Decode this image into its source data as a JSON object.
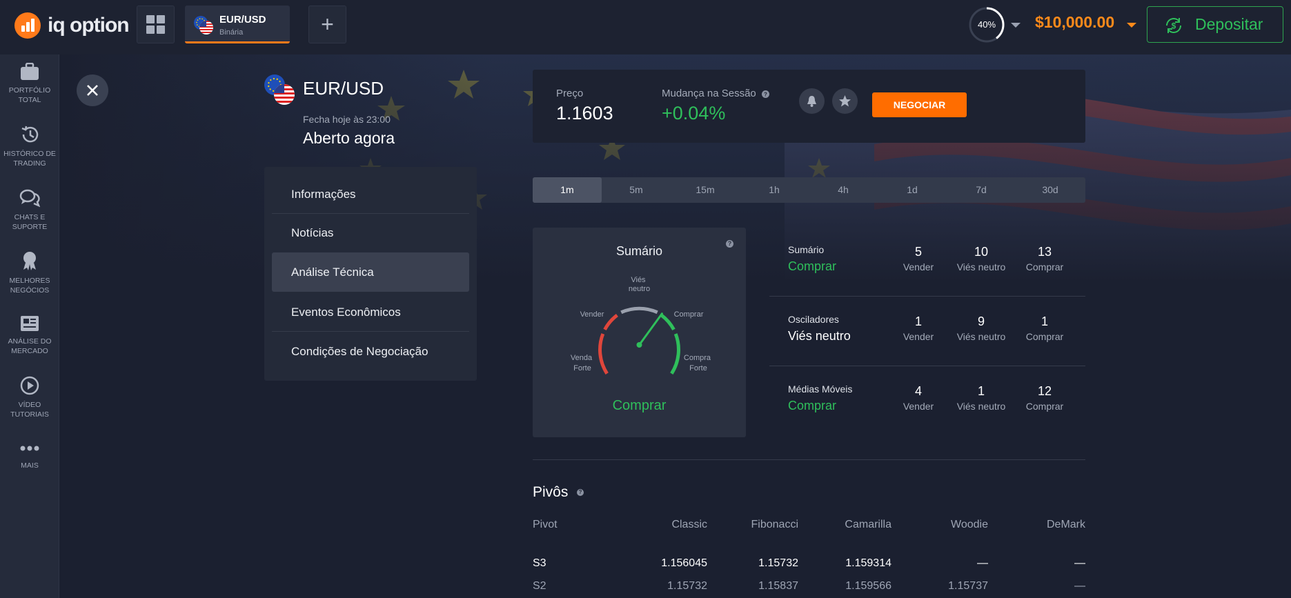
{
  "topbar": {
    "brand": "iq option",
    "asset_tab": {
      "symbol": "EUR/USD",
      "type": "Binária"
    },
    "profit_percent": "40%",
    "profit_fraction": 0.4,
    "balance": "$10,000.00",
    "deposit_label": "Depositar"
  },
  "sidebar": {
    "items": [
      {
        "icon": "briefcase-icon",
        "label": "PORTFÓLIO\nTOTAL"
      },
      {
        "icon": "history-icon",
        "label": "HISTÓRICO DE\nTRADING"
      },
      {
        "icon": "chat-icon",
        "label": "CHATS E\nSUPORTE"
      },
      {
        "icon": "medal-icon",
        "label": "MELHORES\nNEGÓCIOS"
      },
      {
        "icon": "newspaper-icon",
        "label": "ANÁLISE DO\nMERCADO"
      },
      {
        "icon": "play-icon",
        "label": "VÍDEO\nTUTORIAIS"
      },
      {
        "icon": "more-dots-icon",
        "label": "MAIS"
      }
    ]
  },
  "asset": {
    "name": "EUR/USD",
    "closes": "Fecha hoje às 23:00",
    "status": "Aberto agora"
  },
  "menu": {
    "items": [
      "Informações",
      "Notícias",
      "Análise Técnica",
      "Eventos Econômicos",
      "Condições de Negociação"
    ],
    "active": "Análise Técnica"
  },
  "price_card": {
    "price_label": "Preço",
    "price_value": "1.1603",
    "change_label": "Mudança na Sessão",
    "change_value": "+0.04%",
    "trade_button": "NEGOCIAR"
  },
  "timeframes": {
    "items": [
      "1m",
      "5m",
      "15m",
      "1h",
      "4h",
      "1d",
      "7d",
      "30d"
    ],
    "active": "1m"
  },
  "gauge": {
    "title": "Sumário",
    "labels": {
      "neutral": "Viés\nneutro",
      "sell": "Vender",
      "buy": "Comprar",
      "strong_sell": "Venda\nForte",
      "strong_buy": "Compra\nForte"
    },
    "verdict": "Comprar"
  },
  "summary": {
    "rows": [
      {
        "name": "Sumário",
        "verdict": "Comprar",
        "sell": "5",
        "neutral": "10",
        "buy": "13"
      },
      {
        "name": "Osciladores",
        "verdict": "Viés neutro",
        "sell": "1",
        "neutral": "9",
        "buy": "1"
      },
      {
        "name": "Médias Móveis",
        "verdict": "Comprar",
        "sell": "4",
        "neutral": "1",
        "buy": "12"
      }
    ],
    "captions": {
      "sell": "Vender",
      "neutral": "Viés neutro",
      "buy": "Comprar"
    }
  },
  "pivots": {
    "title": "Pivôs",
    "columns": [
      "Pivot",
      "Classic",
      "Fibonacci",
      "Camarilla",
      "Woodie",
      "DeMark"
    ],
    "rows": [
      [
        "S3",
        "1.156045",
        "1.15732",
        "1.159314",
        "—",
        "—"
      ],
      [
        "S2",
        "1.15732",
        "1.15837",
        "1.159566",
        "1.15737",
        "—"
      ]
    ]
  },
  "colors": {
    "accent": "#ff7a1a",
    "positive": "#2fbf5b",
    "negative": "#e0463b"
  }
}
